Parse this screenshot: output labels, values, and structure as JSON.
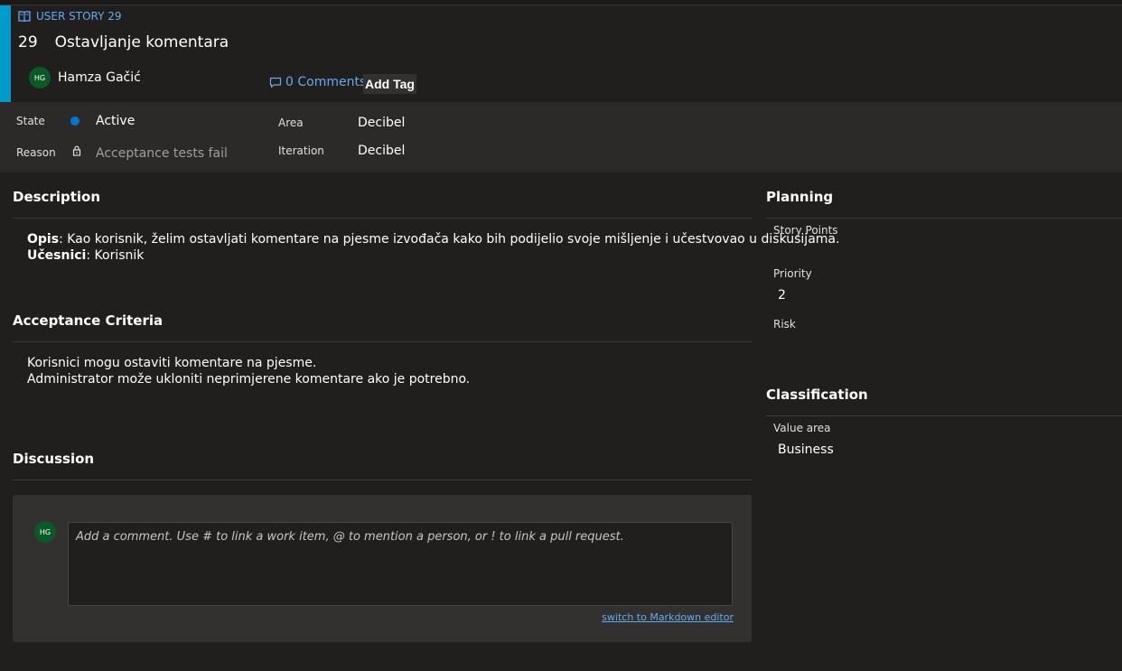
{
  "header": {
    "type_label": "USER STORY 29",
    "id": "29",
    "title": "Ostavljanje komentara",
    "owner_initials": "HG",
    "owner_name": "Hamza Gačić",
    "comments_label": "0 Comments",
    "add_tag_label": "Add Tag",
    "accent_color": "#009ccc"
  },
  "fields": {
    "state_label": "State",
    "state_value": "Active",
    "state_color": "#0078d4",
    "reason_label": "Reason",
    "reason_value": "Acceptance tests fail",
    "area_label": "Area",
    "area_value": "Decibel",
    "iteration_label": "Iteration",
    "iteration_value": "Decibel"
  },
  "description": {
    "title": "Description",
    "opis_label": "Opis",
    "opis_text": ": Kao korisnik, želim ostavljati komentare na pjesme izvođača kako bih podijelio svoje mišljenje i učestvovao u diskusijama.",
    "ucesnici_label": "Učesnici",
    "ucesnici_text": ": Korisnik"
  },
  "acceptance": {
    "title": "Acceptance Criteria",
    "line1": "Korisnici mogu ostaviti komentare na pjesme.",
    "line2": "Administrator može ukloniti neprimjerene komentare ako je potrebno."
  },
  "discussion": {
    "title": "Discussion",
    "avatar_initials": "HG",
    "placeholder": "Add a comment. Use # to link a work item, @ to mention a person, or ! to link a pull request.",
    "switch_link": "switch to Markdown editor"
  },
  "planning": {
    "title": "Planning",
    "story_points_label": "Story Points",
    "story_points_value": "",
    "priority_label": "Priority",
    "priority_value": "2",
    "risk_label": "Risk",
    "risk_value": ""
  },
  "classification": {
    "title": "Classification",
    "value_area_label": "Value area",
    "value_area_value": "Business"
  }
}
